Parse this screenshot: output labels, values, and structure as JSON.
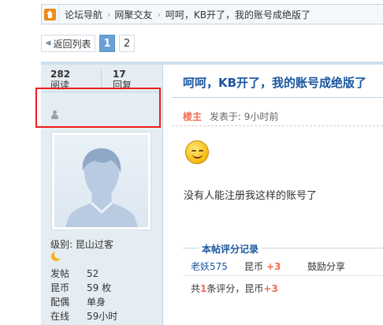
{
  "breadcrumb": {
    "items": [
      "论坛导航",
      "网聚交友"
    ],
    "separator": "›",
    "current": "呵呵，KB开了，我的账号成绝版了"
  },
  "pager": {
    "back_label": "返回列表",
    "pages": [
      "1",
      "2"
    ],
    "current_page": "1"
  },
  "stats": {
    "views_count": "282",
    "views_label": "阅读",
    "replies_count": "17",
    "replies_label": "回复"
  },
  "user": {
    "level_label": "级别: 昆山过客",
    "fields": [
      {
        "key": "发帖",
        "value": "52"
      },
      {
        "key": "昆币",
        "value": "59 枚"
      },
      {
        "key": "配偶",
        "value": "单身"
      },
      {
        "key": "在线",
        "value": "59小时"
      }
    ]
  },
  "post": {
    "title": "呵呵，KB开了，我的账号成绝版了",
    "author_badge": "楼主",
    "posted_time": "发表于: 9小时前",
    "content": "没有人能注册我这样的账号了"
  },
  "rating": {
    "header": "本帖评分记录",
    "rows": [
      {
        "user": "老妖575",
        "kind": "昆币",
        "amount": "+3",
        "reason": "鼓励分享"
      }
    ],
    "summary_prefix": "共",
    "summary_count": "1",
    "summary_mid": "条评分，昆币",
    "summary_amount": "+3"
  },
  "colors": {
    "accent_blue": "#1a56a0",
    "highlight_red": "#ee1c1c",
    "sidebar_bg": "#e5edf2",
    "current_page_bg": "#6aa0d6"
  }
}
